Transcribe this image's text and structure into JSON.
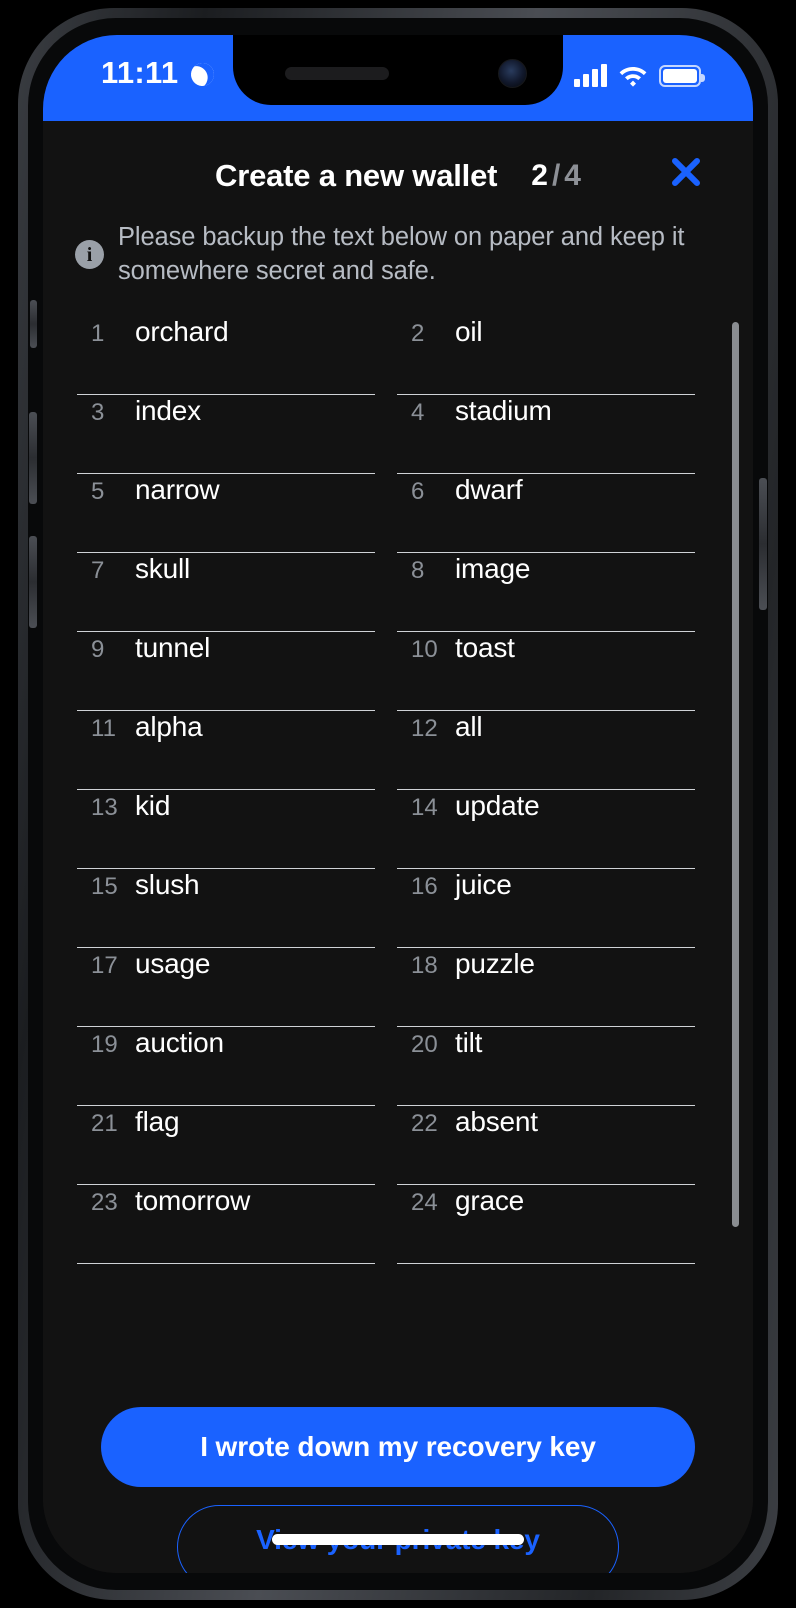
{
  "status_bar": {
    "time": "11:11",
    "moon_icon": "moon-icon",
    "signal_icon": "signal-bars-icon",
    "wifi_icon": "wifi-icon",
    "battery_icon": "battery-full-icon"
  },
  "header": {
    "title": "Create a new wallet",
    "step_current": "2",
    "step_separator": "/",
    "step_total": "4",
    "close_icon": "close-icon"
  },
  "info": {
    "icon": "info-icon",
    "icon_glyph": "i",
    "text": "Please backup the text below on paper and keep it somewhere secret and safe."
  },
  "mnemonic": {
    "words": [
      {
        "index": "1",
        "word": "orchard"
      },
      {
        "index": "2",
        "word": "oil"
      },
      {
        "index": "3",
        "word": "index"
      },
      {
        "index": "4",
        "word": "stadium"
      },
      {
        "index": "5",
        "word": "narrow"
      },
      {
        "index": "6",
        "word": "dwarf"
      },
      {
        "index": "7",
        "word": "skull"
      },
      {
        "index": "8",
        "word": "image"
      },
      {
        "index": "9",
        "word": "tunnel"
      },
      {
        "index": "10",
        "word": "toast"
      },
      {
        "index": "11",
        "word": "alpha"
      },
      {
        "index": "12",
        "word": "all"
      },
      {
        "index": "13",
        "word": "kid"
      },
      {
        "index": "14",
        "word": "update"
      },
      {
        "index": "15",
        "word": "slush"
      },
      {
        "index": "16",
        "word": "juice"
      },
      {
        "index": "17",
        "word": "usage"
      },
      {
        "index": "18",
        "word": "puzzle"
      },
      {
        "index": "19",
        "word": "auction"
      },
      {
        "index": "20",
        "word": "tilt"
      },
      {
        "index": "21",
        "word": "flag"
      },
      {
        "index": "22",
        "word": "absent"
      },
      {
        "index": "23",
        "word": "tomorrow"
      },
      {
        "index": "24",
        "word": "grace"
      }
    ]
  },
  "footer": {
    "primary_label": "I wrote down my recovery key",
    "secondary_label": "View your private key"
  },
  "colors": {
    "accent": "#1a62ff",
    "screen_bg": "#121212",
    "muted_text": "#8b9097",
    "info_text": "#b7bcc4",
    "divider": "#cfd2d6"
  }
}
